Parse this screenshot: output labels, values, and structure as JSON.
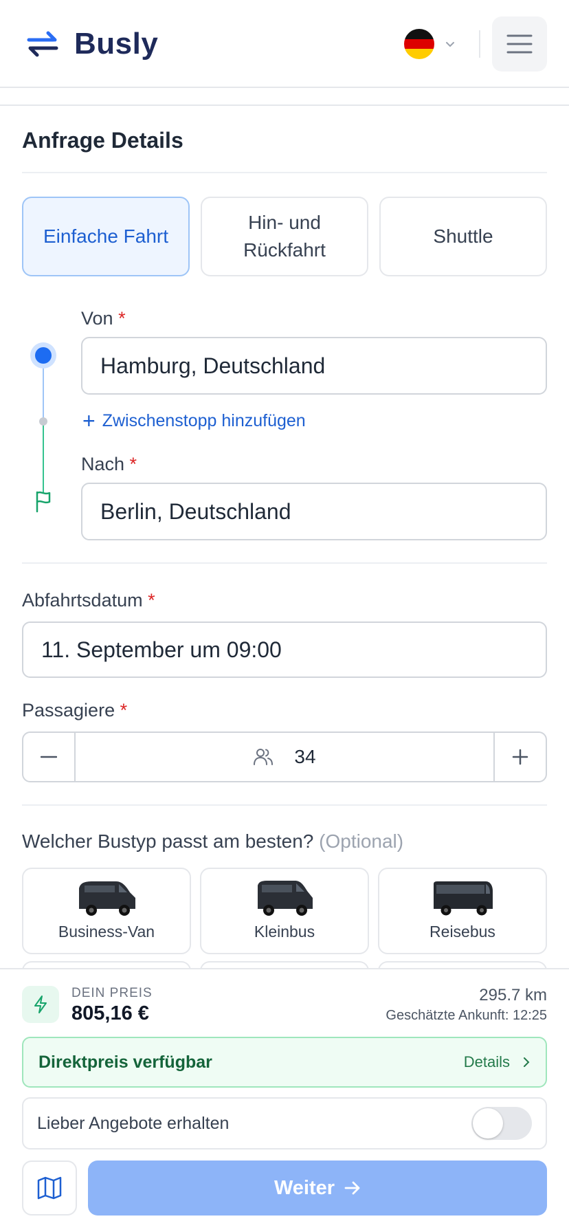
{
  "header": {
    "brand": "Busly",
    "language_flag": "de-flag-icon",
    "colors": {
      "brand": "#1e2a5a",
      "accent": "#1d6cf2"
    }
  },
  "section_title": "Anfrage Details",
  "trip_types": [
    {
      "label": "Einfache Fahrt",
      "selected": true
    },
    {
      "label": "Hin- und Rückfahrt",
      "selected": false
    },
    {
      "label": "Shuttle",
      "selected": false
    }
  ],
  "route": {
    "from_label": "Von",
    "from_value": "Hamburg, Deutschland",
    "add_stop": "Zwischenstopp hinzufügen",
    "to_label": "Nach",
    "to_value": "Berlin, Deutschland"
  },
  "departure": {
    "label": "Abfahrtsdatum",
    "value": "11. September um 09:00"
  },
  "passengers": {
    "label": "Passagiere",
    "value": "34"
  },
  "bus_type": {
    "question": "Welcher Bustyp passt am besten?",
    "optional": "(Optional)",
    "options": [
      {
        "label": "Business-Van",
        "icon": "van-icon"
      },
      {
        "label": "Kleinbus",
        "icon": "minibus-icon"
      },
      {
        "label": "Reisebus",
        "icon": "coach-icon"
      }
    ]
  },
  "price_panel": {
    "price_label": "DEIN PREIS",
    "price": "805,16 €",
    "distance": "295.7 km",
    "eta": "Geschätzte Ankunft: 12:25",
    "direct_price": "Direktpreis verfügbar",
    "details": "Details",
    "offers_label": "Lieber Angebote erhalten",
    "offers_toggle_on": false,
    "next_button": "Weiter"
  }
}
